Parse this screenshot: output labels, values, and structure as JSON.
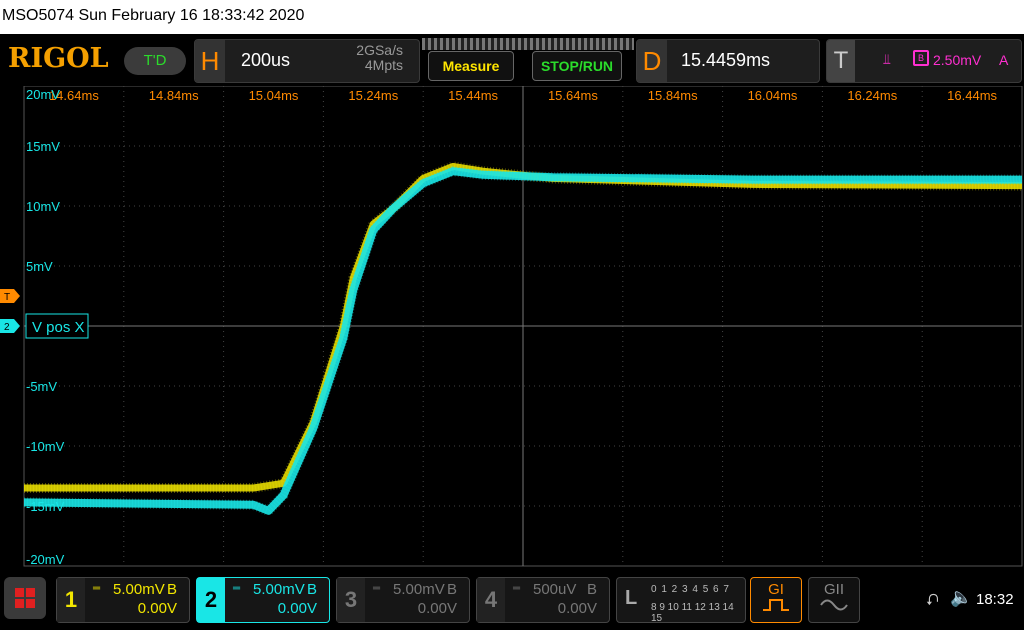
{
  "title": "MSO5074  Sun February 16 18:33:42 2020",
  "brand": "RIGOL",
  "trig_status": "T'D",
  "horizontal": {
    "label": "H",
    "timebase": "200us",
    "sample_rate": "2GSa/s",
    "memory_depth": "4Mpts"
  },
  "buttons": {
    "measure": "Measure",
    "stop_run": "STOP/RUN"
  },
  "delay": {
    "label": "D",
    "value": "15.4459ms"
  },
  "trigger": {
    "label": "T",
    "edge_icon": "rising-edge-icon",
    "source": "B",
    "level": "2.50mV",
    "mode": "A"
  },
  "graticule": {
    "time_labels": [
      "14.64ms",
      "14.84ms",
      "15.04ms",
      "15.24ms",
      "15.44ms",
      "15.64ms",
      "15.84ms",
      "16.04ms",
      "16.24ms",
      "16.44ms"
    ],
    "volt_labels": [
      "20mV",
      "15mV",
      "10mV",
      "5mV",
      "-5mV",
      "-10mV",
      "-15mV",
      "-20mV"
    ],
    "trigger_marker": "T",
    "channel_marker": "2",
    "channel_label": "V pos X"
  },
  "waveforms": [
    {
      "name": "CH1",
      "color": "#f2e600",
      "points": [
        [
          14.54,
          -13.5
        ],
        [
          15.0,
          -13.5
        ],
        [
          15.06,
          -13.1
        ],
        [
          15.12,
          -8.0
        ],
        [
          15.18,
          0.0
        ],
        [
          15.2,
          4.0
        ],
        [
          15.24,
          8.5
        ],
        [
          15.28,
          9.8
        ],
        [
          15.34,
          12.3
        ],
        [
          15.4,
          13.3
        ],
        [
          15.46,
          12.9
        ],
        [
          15.6,
          12.3
        ],
        [
          16.0,
          11.8
        ],
        [
          16.54,
          11.7
        ]
      ]
    },
    {
      "name": "CH2",
      "color": "#19e6e6",
      "points": [
        [
          14.54,
          -14.7
        ],
        [
          15.0,
          -14.9
        ],
        [
          15.03,
          -15.4
        ],
        [
          15.06,
          -14.1
        ],
        [
          15.12,
          -8.5
        ],
        [
          15.18,
          -1.0
        ],
        [
          15.2,
          3.0
        ],
        [
          15.24,
          8.0
        ],
        [
          15.28,
          9.8
        ],
        [
          15.34,
          11.9
        ],
        [
          15.4,
          12.9
        ],
        [
          15.46,
          12.6
        ],
        [
          15.6,
          12.4
        ],
        [
          16.0,
          12.2
        ],
        [
          16.54,
          12.2
        ]
      ]
    }
  ],
  "channels": [
    {
      "num": "1",
      "color": "#f2e600",
      "scale": "5.00mV",
      "coupling": "B",
      "offset": "0.00V"
    },
    {
      "num": "2",
      "color": "#19e6e6",
      "scale": "5.00mV",
      "coupling": "B",
      "offset": "0.00V"
    },
    {
      "num": "3",
      "color": "#777777",
      "scale": "5.00mV",
      "coupling": "B",
      "offset": "0.00V"
    },
    {
      "num": "4",
      "color": "#777777",
      "scale": "500uV",
      "coupling": "B",
      "offset": "0.00V"
    }
  ],
  "logic": {
    "label": "L",
    "row1": "0 1 2 3  4 5 6 7",
    "row2": "8 9 10 11 12 13 14 15"
  },
  "generators": {
    "g1": "GI",
    "g2": "GII"
  },
  "status": {
    "clock": "18:32"
  }
}
